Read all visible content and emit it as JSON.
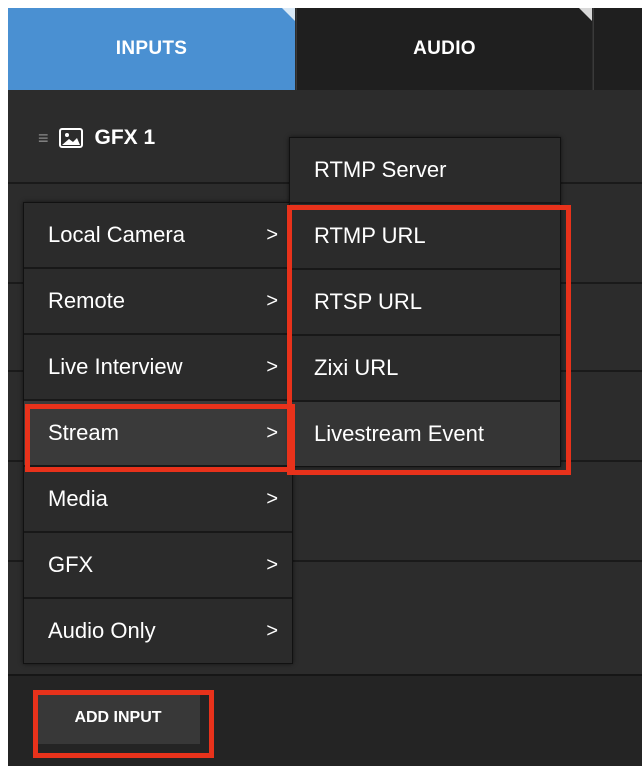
{
  "tabs": [
    {
      "label": "INPUTS",
      "active": true
    },
    {
      "label": "AUDIO",
      "active": false
    },
    {
      "label": "",
      "active": false
    }
  ],
  "source_row": {
    "icon": "image-icon",
    "label": "GFX 1"
  },
  "menu": {
    "items": [
      {
        "label": "Local Camera",
        "chevron": ">"
      },
      {
        "label": "Remote",
        "chevron": ">"
      },
      {
        "label": "Live Interview",
        "chevron": ">"
      },
      {
        "label": "Stream",
        "chevron": ">"
      },
      {
        "label": "Media",
        "chevron": ">"
      },
      {
        "label": "GFX",
        "chevron": ">"
      },
      {
        "label": "Audio Only",
        "chevron": ">"
      }
    ]
  },
  "submenu": {
    "items": [
      {
        "label": "RTMP Server"
      },
      {
        "label": "RTMP URL"
      },
      {
        "label": "RTSP URL"
      },
      {
        "label": "Zixi URL"
      },
      {
        "label": "Livestream Event"
      }
    ]
  },
  "footer": {
    "add_input_label": "ADD INPUT"
  },
  "colors": {
    "accent": "#4a90d2",
    "highlight": "#e8321b",
    "panel": "#2c2c2c"
  }
}
